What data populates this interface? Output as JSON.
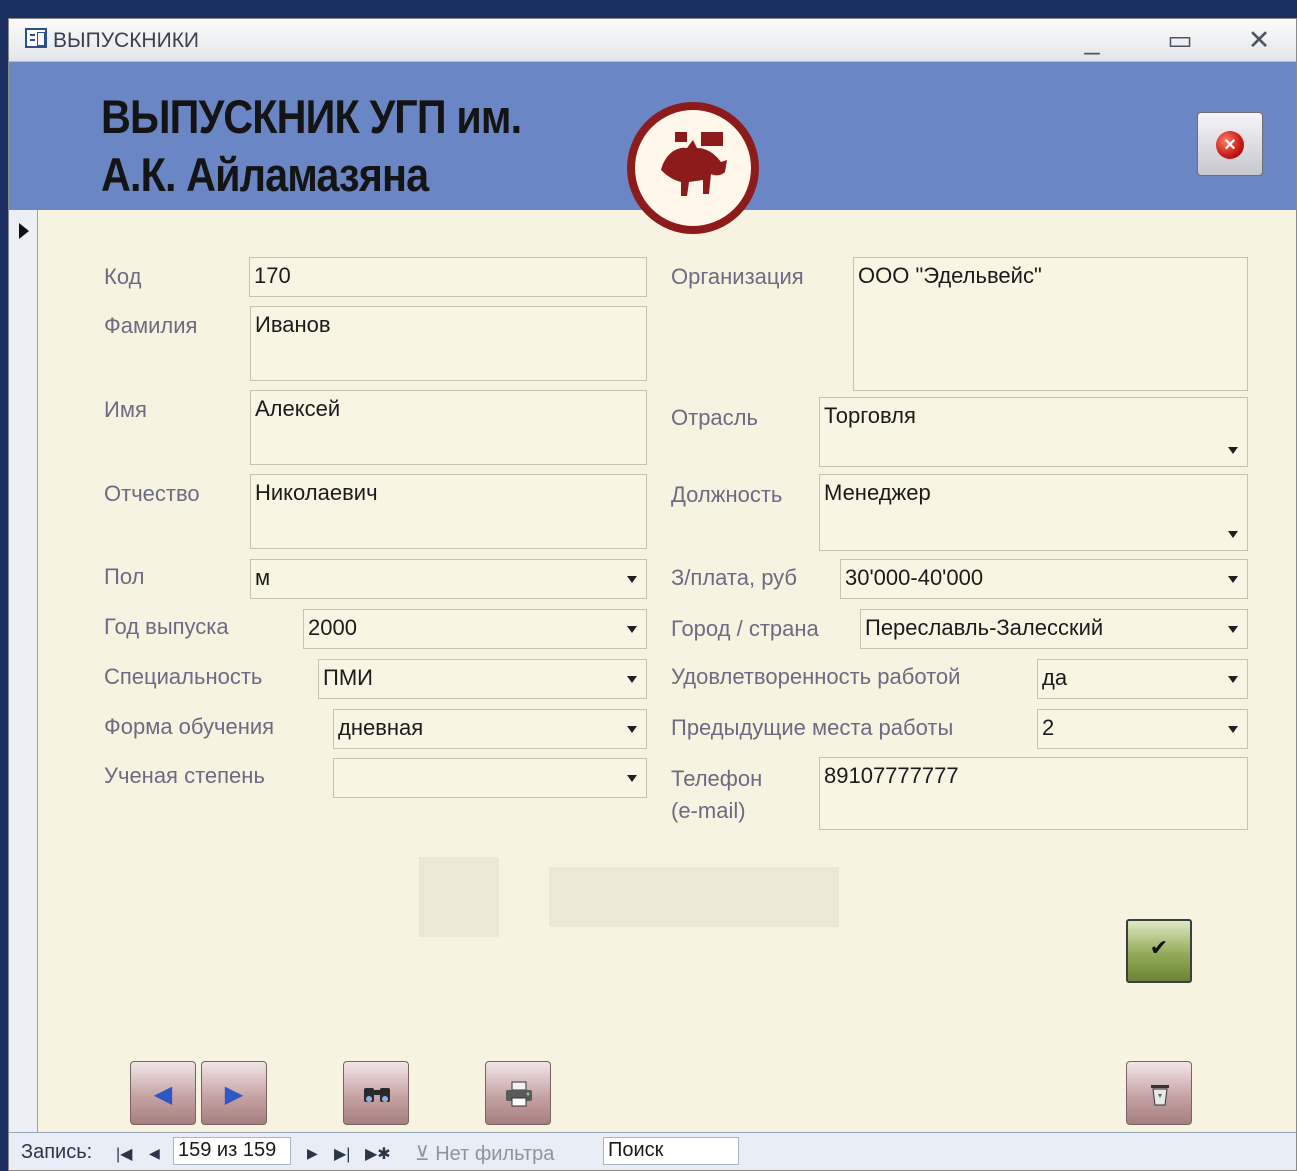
{
  "window": {
    "title": "ВЫПУСКНИКИ",
    "minimize": "_",
    "maximize": "▭",
    "close": "✕"
  },
  "header": {
    "title_line1": "ВЫПУСКНИК УГП им.",
    "title_line2": "А.К. Айламазяна"
  },
  "form": {
    "left": [
      {
        "label": "Код",
        "value": "170"
      },
      {
        "label": "Фамилия",
        "value": "Иванов"
      },
      {
        "label": "Имя",
        "value": "Алексей"
      },
      {
        "label": "Отчество",
        "value": "Николаевич"
      },
      {
        "label": "Пол",
        "value": "м"
      },
      {
        "label": "Год выпуска",
        "value": "2000"
      },
      {
        "label": "Специальность",
        "value": "ПМИ"
      },
      {
        "label": "Форма обучения",
        "value": "дневная"
      },
      {
        "label": "Ученая степень",
        "value": ""
      }
    ],
    "right": [
      {
        "label": "Организация",
        "value": "ООО \"Эдельвейс\""
      },
      {
        "label": "Отрасль",
        "value": "Торговля"
      },
      {
        "label": "Должность",
        "value": "Менеджер"
      },
      {
        "label": "З/плата, руб",
        "value": "30'000-40'000"
      },
      {
        "label": "Город / страна",
        "value": "Переславль-Залесский"
      },
      {
        "label": "Удовлетворенность работой",
        "value": "да"
      },
      {
        "label": "Предыдущие места работы",
        "value": "2"
      },
      {
        "label_line1": "Телефон",
        "label_line2": "(e-mail)",
        "value": "89107777777"
      }
    ]
  },
  "statusbar": {
    "record_label": "Запись:",
    "record_value": "159 из 159",
    "filter_label": "Нет фильтра",
    "search_label": "Поиск"
  },
  "icons": {
    "prev": "◀",
    "next": "▶",
    "find": "binoculars-icon",
    "print": "printer-icon",
    "delete": "trash-icon",
    "save": "✔"
  },
  "colors": {
    "header": "#6b86c5",
    "form_bg": "#f7f3e1",
    "logo_ring": "#8d1b1b",
    "save_button": "#92ab58"
  }
}
